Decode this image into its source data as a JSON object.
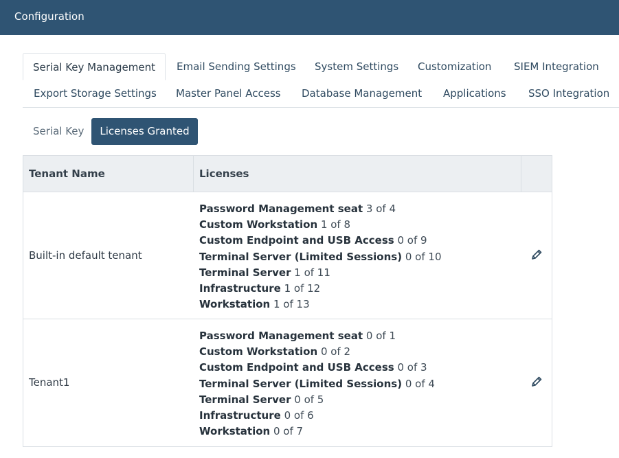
{
  "header": {
    "title": "Configuration"
  },
  "tabs": [
    {
      "label": "Serial Key Management"
    },
    {
      "label": "Email Sending Settings"
    },
    {
      "label": "System Settings"
    },
    {
      "label": "Customization"
    },
    {
      "label": "SIEM Integration"
    },
    {
      "label": "Export Storage Settings"
    },
    {
      "label": "Master Panel Access"
    },
    {
      "label": "Database Management"
    },
    {
      "label": "Applications"
    },
    {
      "label": "SSO Integration"
    }
  ],
  "subtabs": [
    {
      "label": "Serial Key"
    },
    {
      "label": "Licenses Granted"
    }
  ],
  "table": {
    "columns": [
      "Tenant Name",
      "Licenses"
    ],
    "rows": [
      {
        "tenant": "Built-in default tenant",
        "licenses": [
          {
            "name": "Password Management seat",
            "count": "3 of 4"
          },
          {
            "name": "Custom Workstation",
            "count": "1 of 8"
          },
          {
            "name": "Custom Endpoint and USB Access",
            "count": "0 of 9"
          },
          {
            "name": "Terminal Server (Limited Sessions)",
            "count": "0 of 10"
          },
          {
            "name": "Terminal Server",
            "count": "1 of 11"
          },
          {
            "name": "Infrastructure",
            "count": "1 of 12"
          },
          {
            "name": "Workstation",
            "count": "1 of 13"
          }
        ]
      },
      {
        "tenant": "Tenant1",
        "licenses": [
          {
            "name": "Password Management seat",
            "count": "0 of 1"
          },
          {
            "name": "Custom Workstation",
            "count": "0 of 2"
          },
          {
            "name": "Custom Endpoint and USB Access",
            "count": "0 of 3"
          },
          {
            "name": "Terminal Server (Limited Sessions)",
            "count": "0 of 4"
          },
          {
            "name": "Terminal Server",
            "count": "0 of 5"
          },
          {
            "name": "Infrastructure",
            "count": "0 of 6"
          },
          {
            "name": "Workstation",
            "count": "0 of 7"
          }
        ]
      }
    ]
  },
  "colors": {
    "header_bg": "#2f5473",
    "active_subtab": "#2f5473",
    "grid_header_bg": "#eceff2"
  },
  "icons": {
    "edit": "pencil-icon"
  }
}
